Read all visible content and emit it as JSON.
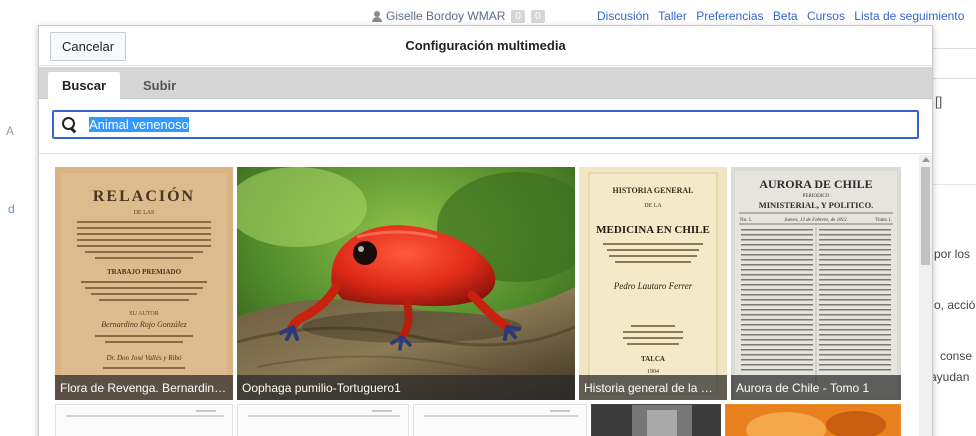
{
  "background": {
    "user_name": "Giselle Bordoy WMAR",
    "notif_count_1": "0",
    "notif_count_2": "0",
    "links": [
      "Discusión",
      "Taller",
      "Preferencias",
      "Beta",
      "Cursos",
      "Lista de seguimiento"
    ],
    "edit_fragment": "[]",
    "text_fragments": [
      "por los",
      "o, acció",
      "conse",
      "ayudan"
    ],
    "left_glyph_1": "A",
    "left_glyph_2": "d"
  },
  "dialog": {
    "title": "Configuración multimedia",
    "cancel_label": "Cancelar",
    "tabs": [
      {
        "label": "Buscar",
        "active": true
      },
      {
        "label": "Subir",
        "active": false
      }
    ],
    "search": {
      "value": "Animal venenoso",
      "icon": "search-icon"
    },
    "results": [
      {
        "caption": "Flora de Revenga. Bernardino Rojo González",
        "kind": "document-scan"
      },
      {
        "caption": "Oophaga pumilio-Tortuguero1",
        "kind": "photo-frog"
      },
      {
        "caption": "Historia general de la medicina en Chile",
        "kind": "document-scan"
      },
      {
        "caption": "Aurora de Chile - Tomo 1",
        "kind": "newspaper-scan"
      }
    ],
    "scan_text": {
      "flora": [
        "RELACIÓN",
        "DE LAS",
        "TRABAJO PREMIADO",
        "SU AUTOR",
        "Bernardino Rojo González",
        "Dr. Don José Vallés y Ribó"
      ],
      "historia": [
        "HISTORIA GENERAL",
        "DE LA",
        "MEDICINA EN CHILE",
        "Pedro Lautaro Ferrer",
        "TALCA",
        "1904"
      ],
      "aurora": [
        "AURORA DE CHILE",
        "PERIODICO",
        "MINISTERIAL, Y POLITICO.",
        "No. 1.",
        "Jueves, 13 de Febrero, de 1812.",
        "Tomo 1."
      ]
    }
  }
}
